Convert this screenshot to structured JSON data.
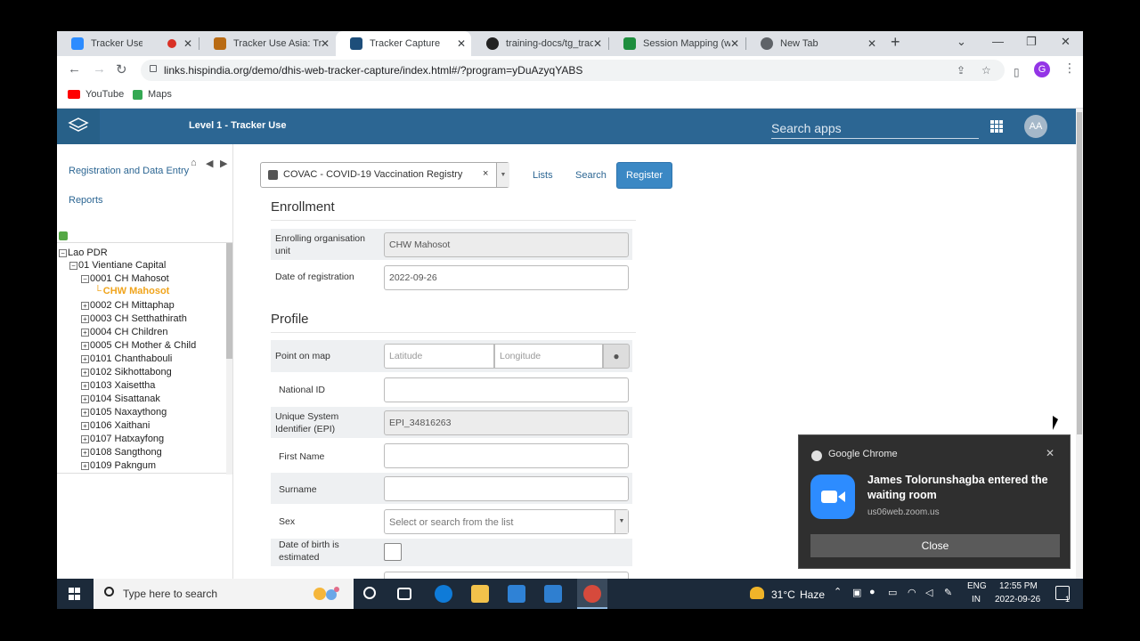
{
  "browser": {
    "tabs": [
      {
        "title": "Tracker Use Asia",
        "close": "✕",
        "icon_color": "#2d8cff",
        "icon": "zoom-icon"
      },
      {
        "title": "Tracker Use Asia: Track",
        "close": "✕",
        "icon_color": "#b96b14",
        "icon": "moodle-icon"
      },
      {
        "title": "Tracker Capture",
        "close": "✕",
        "icon_color": "#1d4e7a",
        "icon": "dhis2-icon"
      },
      {
        "title": "training-docs/tg_track",
        "close": "✕",
        "icon_color": "#222222",
        "icon": "github-icon"
      },
      {
        "title": "Session Mapping (wh",
        "close": "✕",
        "icon_color": "#1e8e3e",
        "icon": "sheets-icon"
      },
      {
        "title": "New Tab",
        "close": "✕",
        "icon_color": "#5f6368",
        "icon": "chrome-icon"
      }
    ],
    "new_tab": "+",
    "url": "links.hispindia.org/demo/dhis-web-tracker-capture/index.html#/?program=yDuAzyqYABS",
    "profile_initial": "G",
    "bookmarks": [
      {
        "label": "YouTube",
        "color": "#ff0000"
      },
      {
        "label": "Maps",
        "color": "#34a853"
      }
    ]
  },
  "header": {
    "title": "Level 1 - Tracker Use",
    "search_placeholder": "Search apps",
    "avatar": "AA",
    "bg_color": "#2c6693"
  },
  "leftpanel": {
    "links": [
      "Registration and Data Entry",
      "Reports"
    ],
    "tree": [
      {
        "label": "Lao PDR",
        "level": 0,
        "exp": "−"
      },
      {
        "label": "01 Vientiane Capital",
        "level": 1,
        "exp": "−"
      },
      {
        "label": "0001 CH Mahosot",
        "level": 2,
        "exp": "−"
      },
      {
        "label": "CHW Mahosot",
        "level": 3,
        "exp": "",
        "selected": true
      },
      {
        "label": "0002 CH Mittaphap",
        "level": 2,
        "exp": "+"
      },
      {
        "label": "0003 CH Setthathirath",
        "level": 2,
        "exp": "+"
      },
      {
        "label": "0004 CH Children",
        "level": 2,
        "exp": "+"
      },
      {
        "label": "0005 CH Mother & Child",
        "level": 2,
        "exp": "+"
      },
      {
        "label": "0101 Chanthabouli",
        "level": 2,
        "exp": "+"
      },
      {
        "label": "0102 Sikhottabong",
        "level": 2,
        "exp": "+"
      },
      {
        "label": "0103 Xaisettha",
        "level": 2,
        "exp": "+"
      },
      {
        "label": "0104 Sisattanak",
        "level": 2,
        "exp": "+"
      },
      {
        "label": "0105 Naxaythong",
        "level": 2,
        "exp": "+"
      },
      {
        "label": "0106 Xaithani",
        "level": 2,
        "exp": "+"
      },
      {
        "label": "0107 Hatxayfong",
        "level": 2,
        "exp": "+"
      },
      {
        "label": "0108 Sangthong",
        "level": 2,
        "exp": "+"
      },
      {
        "label": "0109 Pakngum",
        "level": 2,
        "exp": "+"
      }
    ]
  },
  "main": {
    "program": "COVAC - COVID-19 Vaccination Registry",
    "program_clear": "×",
    "lists": "Lists",
    "search": "Search",
    "register": "Register",
    "enrollment_title": "Enrollment",
    "enrolling_org_label": "Enrolling organisation unit",
    "enrolling_org_value": "CHW Mahosot",
    "date_label": "Date of registration",
    "date_value": "2022-09-26",
    "profile_title": "Profile",
    "point_label": "Point on map",
    "latitude_placeholder": "Latitude",
    "longitude_placeholder": "Longitude",
    "national_id_label": "National ID",
    "uid_label": "Unique System Identifier (EPI)",
    "uid_value": "EPI_34816263",
    "first_name_label": "First Name",
    "surname_label": "Surname",
    "sex_label": "Sex",
    "sex_placeholder": "Select or search from the list",
    "dob_estimated_label": "Date of birth is estimated"
  },
  "notification": {
    "app": "Google Chrome",
    "title": "James Tolorunshagba entered the waiting room",
    "site": "us06web.zoom.us",
    "close": "Close",
    "x": "✕"
  },
  "taskbar": {
    "search_text": "Type here to search",
    "temperature": "31°C",
    "weather": "Haze",
    "lang1": "ENG",
    "lang2": "IN",
    "time": "12:55 PM",
    "date": "2022-09-26",
    "notif_count": "1"
  }
}
